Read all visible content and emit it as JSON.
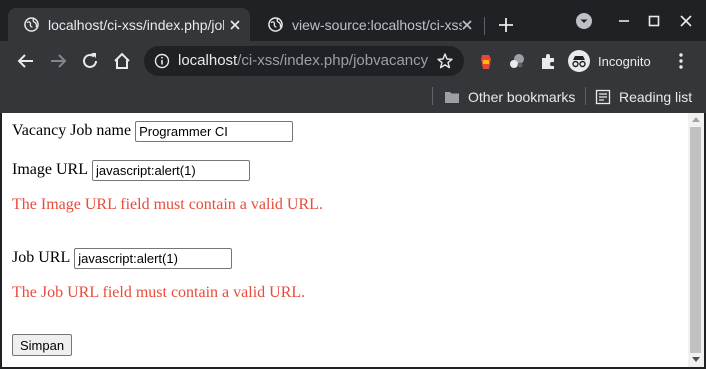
{
  "tabs": [
    {
      "title": "localhost/ci-xss/index.php/jobvacancy",
      "active": true
    },
    {
      "title": "view-source:localhost/ci-xss/index.php",
      "active": false
    }
  ],
  "omnibox": {
    "url_host": "localhost",
    "url_path": "/ci-xss/index.php/jobvacancy"
  },
  "profile": {
    "label": "Incognito"
  },
  "bookmarks": {
    "other": "Other bookmarks",
    "reading": "Reading list"
  },
  "form": {
    "vacancy_label": "Vacancy Job name",
    "vacancy_value": "Programmer CI",
    "image_label": "Image URL",
    "image_value": "javascript:alert(1)",
    "image_error": "The Image URL field must contain a valid URL.",
    "job_label": "Job URL",
    "job_value": "javascript:alert(1)",
    "job_error": "The Job URL field must contain a valid URL.",
    "submit_label": "Simpan"
  },
  "colors": {
    "error": "#e74c3c",
    "chrome_dark": "#202124",
    "chrome_toolbar": "#35363a"
  }
}
